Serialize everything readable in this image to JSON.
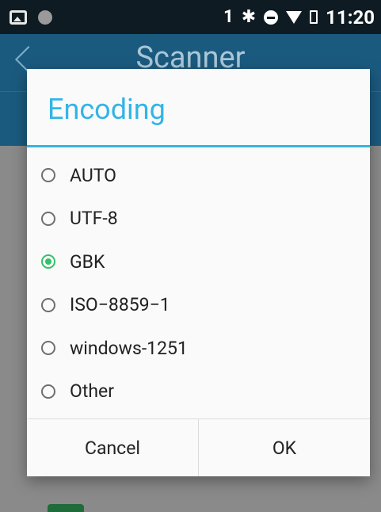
{
  "status_bar": {
    "icons_left": [
      "image-icon",
      "notification-dot-icon"
    ],
    "sim_label": "1",
    "icons_right": [
      "bluetooth-icon",
      "do-not-disturb-icon",
      "wifi-icon",
      "battery-icon"
    ],
    "time": "11:20"
  },
  "app_bar": {
    "title": "Scanner",
    "back_icon": "back-arrow-icon"
  },
  "dialog": {
    "title": "Encoding",
    "options": [
      {
        "label": "AUTO",
        "checked": false
      },
      {
        "label": "UTF-8",
        "checked": false
      },
      {
        "label": "GBK",
        "checked": true
      },
      {
        "label": "ISO−8859−1",
        "checked": false
      },
      {
        "label": "windows-1251",
        "checked": false
      },
      {
        "label": "Other",
        "checked": false
      }
    ],
    "cancel_label": "Cancel",
    "ok_label": "OK"
  },
  "colors": {
    "accent": "#33b5e5",
    "radio_checked": "#33c16a",
    "app_bar": "#1b5a7f"
  }
}
